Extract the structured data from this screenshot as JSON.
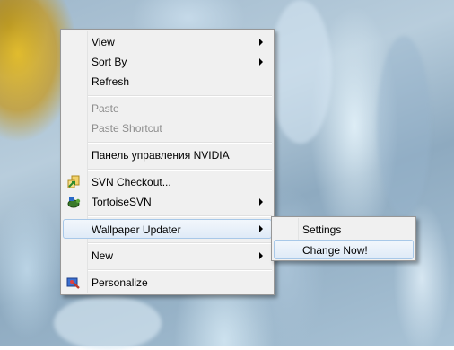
{
  "context_menu": {
    "items": [
      {
        "label": "View"
      },
      {
        "label": "Sort By"
      },
      {
        "label": "Refresh"
      },
      {
        "label": "Paste"
      },
      {
        "label": "Paste Shortcut"
      },
      {
        "label": "Панель управления NVIDIA"
      },
      {
        "label": "SVN Checkout..."
      },
      {
        "label": "TortoiseSVN"
      },
      {
        "label": "Wallpaper Updater"
      },
      {
        "label": "New"
      },
      {
        "label": "Personalize"
      }
    ]
  },
  "submenu": {
    "items": [
      {
        "label": "Settings"
      },
      {
        "label": "Change Now!"
      }
    ]
  },
  "colors": {
    "menu_bg": "#f0f0f0",
    "highlight_border": "#a8c8e8",
    "disabled_text": "#8d8d8d"
  }
}
